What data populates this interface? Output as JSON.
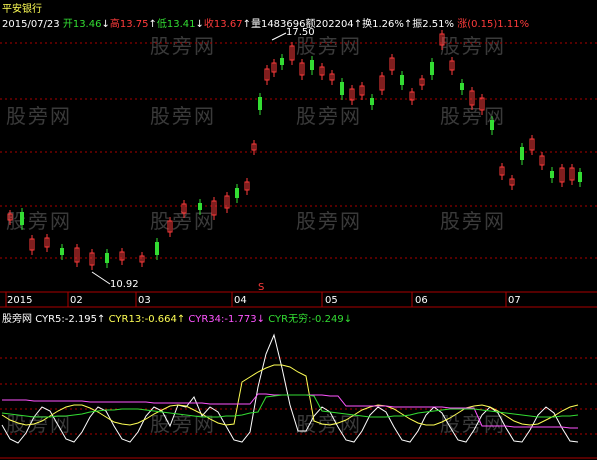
{
  "stock": {
    "name": "平安银行",
    "date": "2015/07/23"
  },
  "quote": {
    "open_label": "开",
    "open": "13.46",
    "high_label": "高",
    "high": "13.75",
    "low_label": "低",
    "low": "13.41",
    "close_label": "收",
    "close": "13.67",
    "volume_label": "量",
    "volume": "1483696",
    "amount_label": "额",
    "amount": "202204",
    "turnover_label": "换",
    "turnover": "1.26%",
    "amplitude_label": "振",
    "amplitude": "2.51%",
    "change_label": "涨",
    "change": "(0.15)",
    "change_pct": "1.11%"
  },
  "annotations": {
    "peak": "17.50",
    "trough": "10.92",
    "marker": "S"
  },
  "x_axis": [
    "2015",
    "02",
    "03",
    "04",
    "05",
    "06",
    "07"
  ],
  "indicator": {
    "name": "股旁网",
    "cyr5_label": "CYR5:",
    "cyr5": "-2.195",
    "cyr13_label": "CYR13:",
    "cyr13": "-0.664",
    "cyr34_label": "CYR34:",
    "cyr34": "-1.773",
    "cyrw_label": "CYR无穷:",
    "cyrw": "-0.249"
  },
  "watermark": "股旁网",
  "colors": {
    "up": "#ff3b3b",
    "down": "#33dd33",
    "cyr5": "#ffffff",
    "cyr13": "#ffff55",
    "cyr34": "#ff55ff",
    "cyrw": "#33dd33",
    "grid": "#aa0000"
  }
}
